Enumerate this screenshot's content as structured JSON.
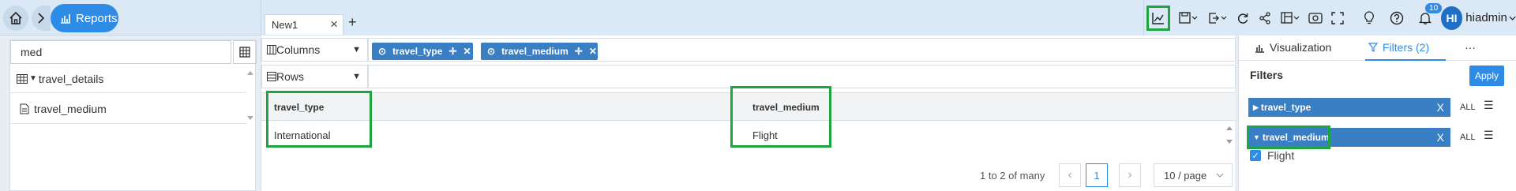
{
  "header": {
    "breadcrumb_label": "Reports",
    "tabs": [
      {
        "label": "New1"
      }
    ],
    "add_tab": "+",
    "notifications_count": "10",
    "avatar_initials": "HI",
    "username": "hiadmin"
  },
  "left_panel": {
    "search_value": "med",
    "tree": [
      {
        "label": "travel_details",
        "icon": "table-icon"
      },
      {
        "label": "travel_medium",
        "icon": "field-icon"
      }
    ]
  },
  "pivot": {
    "columns_label": "Columns",
    "rows_label": "Rows",
    "column_chips": [
      "travel_type",
      "travel_medium"
    ]
  },
  "grid": {
    "headers": [
      "travel_type",
      "travel_medium"
    ],
    "rows": [
      [
        "International",
        "Flight"
      ]
    ]
  },
  "pagination": {
    "summary": "1 to 2 of many",
    "current_page": "1",
    "page_size": "10 / page"
  },
  "right_panel": {
    "tabs": [
      "Visualization",
      "Filters (2)",
      "···"
    ],
    "filters_title": "Filters",
    "apply_label": "Apply",
    "filters": [
      {
        "name": "travel_type",
        "expanded": false,
        "all_label": "ALL"
      },
      {
        "name": "travel_medium",
        "expanded": true,
        "all_label": "ALL",
        "values": [
          "Flight"
        ]
      }
    ]
  },
  "colors": {
    "accent": "#2e8ce6",
    "chip": "#3a7fc4",
    "highlight": "#1fa540"
  }
}
